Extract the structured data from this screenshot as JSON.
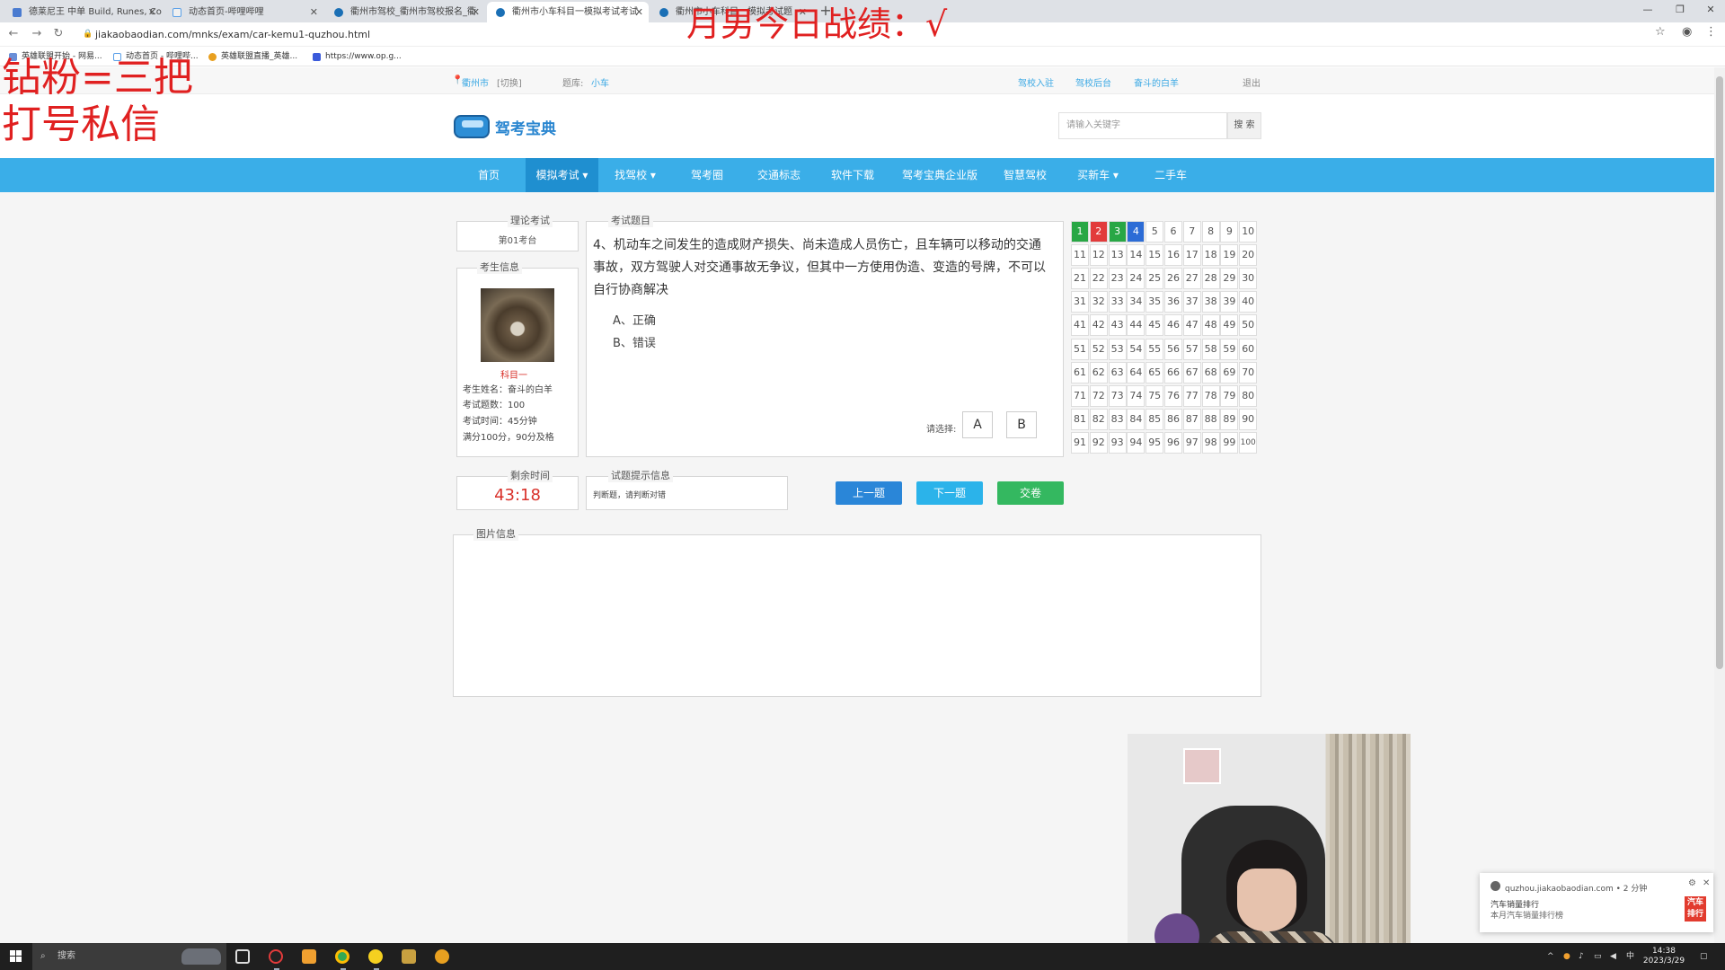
{
  "browser": {
    "tabs": [
      {
        "title": "德莱尼王 中单 Build, Runes, Co",
        "active": false
      },
      {
        "title": "动态首页-哔哩哔哩",
        "active": false
      },
      {
        "title": "衢州市驾校_衢州市驾校报名_衢",
        "active": false
      },
      {
        "title": "衢州市小车科目一模拟考试考试",
        "active": true
      },
      {
        "title": "衢州市小车科目一模拟考试题",
        "active": false
      }
    ],
    "url": "jiakaobaodian.com/mnks/exam/car-kemu1-quzhou.html",
    "bookmarks": [
      "英雄联盟开始 - 网易...",
      "动态首页 - 哔哩哔...",
      "英雄联盟直播_英雄...",
      "https://www.op.g..."
    ]
  },
  "overlay": {
    "title": "月男今日战绩：√",
    "line1": "钻粉=三把",
    "line2": "打号私信"
  },
  "site": {
    "topbar": {
      "city": "衢州市",
      "switch": "[切换]",
      "bank_label": "题库:",
      "bank_value": "小车",
      "links": [
        "驾校入驻",
        "驾校后台",
        "奋斗的白羊"
      ],
      "logout": "退出"
    },
    "logo_text": "驾考宝典",
    "search": {
      "placeholder": "请输入关键字",
      "button": "搜 索"
    },
    "nav": [
      "首页",
      "模拟考试 ▾",
      "找驾校 ▾",
      "驾考圈",
      "交通标志",
      "软件下载",
      "驾考宝典企业版",
      "智慧驾校",
      "买新车 ▾",
      "二手车"
    ]
  },
  "exam": {
    "theory": {
      "legend": "理论考试",
      "seat": "第01考台"
    },
    "student": {
      "legend": "考生信息",
      "subject": "科目一",
      "name": "考生姓名：奋斗的白羊",
      "count": "考试题数：100",
      "time": "考试时间：45分钟",
      "score": "满分100分，90分及格"
    },
    "question": {
      "legend": "考试题目",
      "text": "4、机动车之间发生的造成财产损失、尚未造成人员伤亡，且车辆可以移动的交通事故，双方驾驶人对交通事故无争议，但其中一方使用伪造、变造的号牌，不可以自行协商解决",
      "options": [
        "A、正确",
        "B、错误"
      ],
      "choose_label": "请选择:",
      "answers": [
        "A",
        "B"
      ]
    },
    "grid": {
      "numbers": [
        "1",
        "2",
        "3",
        "4",
        "5",
        "6",
        "7",
        "8",
        "9",
        "10",
        "11",
        "12",
        "13",
        "14",
        "15",
        "16",
        "17",
        "18",
        "19",
        "20",
        "21",
        "22",
        "23",
        "24",
        "25",
        "26",
        "27",
        "28",
        "29",
        "30",
        "31",
        "32",
        "33",
        "34",
        "35",
        "36",
        "37",
        "38",
        "39",
        "40",
        "41",
        "42",
        "43",
        "44",
        "45",
        "46",
        "47",
        "48",
        "49",
        "50",
        "51",
        "52",
        "53",
        "54",
        "55",
        "56",
        "57",
        "58",
        "59",
        "60",
        "61",
        "62",
        "63",
        "64",
        "65",
        "66",
        "67",
        "68",
        "69",
        "70",
        "71",
        "72",
        "73",
        "74",
        "75",
        "76",
        "77",
        "78",
        "79",
        "80",
        "81",
        "82",
        "83",
        "84",
        "85",
        "86",
        "87",
        "88",
        "89",
        "90",
        "91",
        "92",
        "93",
        "94",
        "95",
        "96",
        "97",
        "98",
        "99",
        "100"
      ],
      "status": {
        "1": "correct",
        "2": "wrong",
        "3": "correct",
        "4": "current"
      },
      "colors": {
        "correct": "#28a745",
        "wrong": "#e23b3b",
        "current": "#2c6cd6"
      }
    },
    "timer": {
      "legend": "剩余时间",
      "value": "43:18"
    },
    "hint": {
      "legend": "试题提示信息",
      "text": "判断题，请判断对错"
    },
    "buttons": {
      "prev": "上一题",
      "next": "下一题",
      "submit": "交卷"
    },
    "image_info": {
      "legend": "图片信息"
    }
  },
  "notification": {
    "source": "quzhou.jiakaobaodian.com • 2 分钟",
    "title": "汽车销量排行",
    "body": "本月汽车销量排行榜",
    "logo": "汽车排行"
  },
  "taskbar": {
    "search": "搜索",
    "time": "14:38",
    "date": "2023/3/29",
    "ime": "中"
  }
}
